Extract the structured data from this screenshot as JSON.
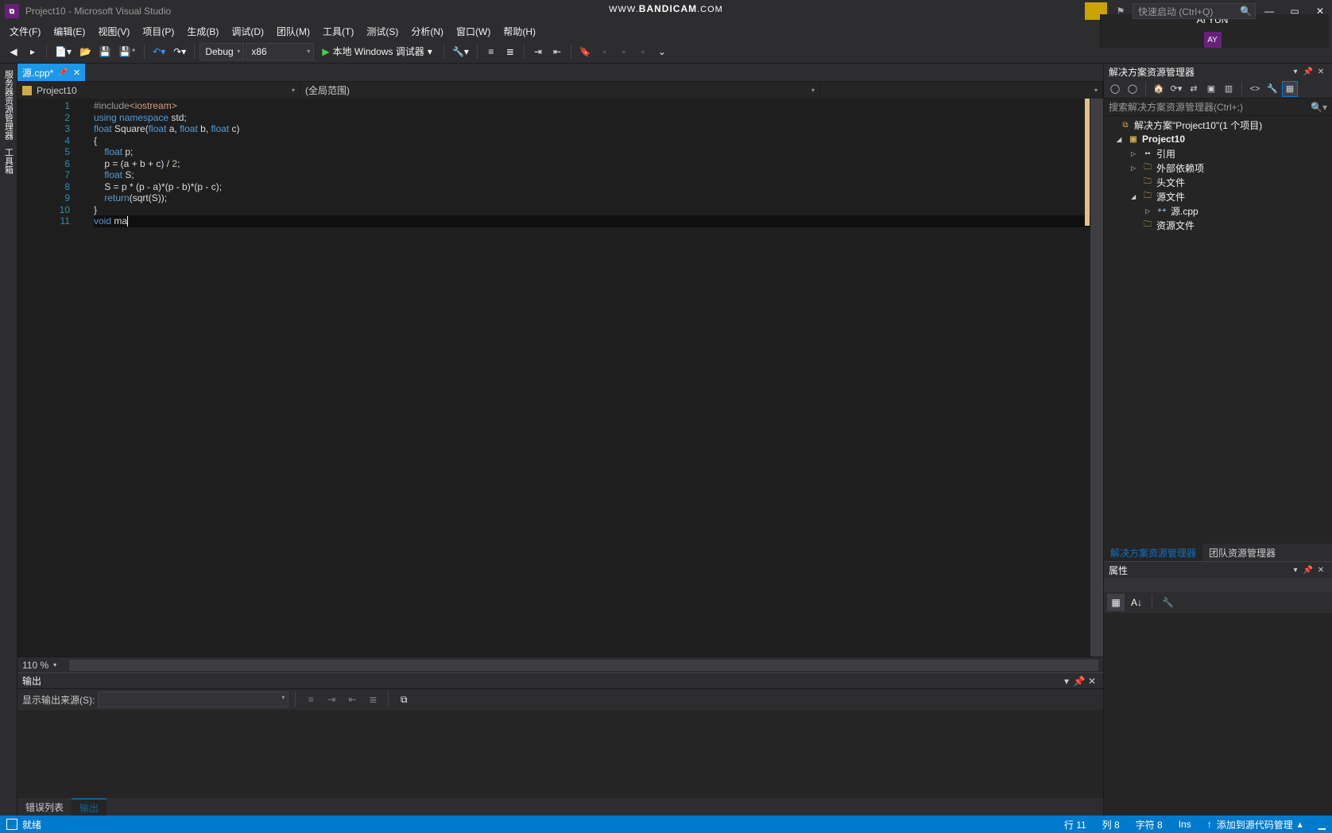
{
  "title": "Project10 - Microsoft Visual Studio",
  "watermark_prefix": "WWW.",
  "watermark_main": "BANDICAM",
  "watermark_suffix": ".COM",
  "quicklaunch_placeholder": "快速启动 (Ctrl+Q)",
  "menu": [
    "文件(F)",
    "编辑(E)",
    "视图(V)",
    "项目(P)",
    "生成(B)",
    "调试(D)",
    "团队(M)",
    "工具(T)",
    "测试(S)",
    "分析(N)",
    "窗口(W)",
    "帮助(H)"
  ],
  "user_label": "AI YUN",
  "user_initials": "AY",
  "toolbar": {
    "config": "Debug",
    "platform": "x86",
    "run": "本地 Windows 调试器"
  },
  "rails": [
    "服务器资源管理器",
    "工具箱"
  ],
  "tab_name": "源.cpp*",
  "nav": {
    "project": "Project10",
    "scope": "(全局范围)"
  },
  "code": {
    "lines": [
      {
        "n": 1,
        "html": "<span class='inc'>#include</span><span class='incpath'>&lt;iostream&gt;</span>"
      },
      {
        "n": 2,
        "html": "<span class='kw'>using</span> <span class='kw'>namespace</span> std;"
      },
      {
        "n": 3,
        "html": "<span class='type'>float</span> Square(<span class='type'>float</span> a, <span class='type'>float</span> b, <span class='type'>float</span> c)"
      },
      {
        "n": 4,
        "html": "{"
      },
      {
        "n": 5,
        "html": "    <span class='type'>float</span> p;"
      },
      {
        "n": 6,
        "html": "    p = (a + b + c) / <span class='num'>2</span>;"
      },
      {
        "n": 7,
        "html": "    <span class='type'>float</span> S;"
      },
      {
        "n": 8,
        "html": "    S = p * (p - a)*(p - b)*(p - c);"
      },
      {
        "n": 9,
        "html": "    <span class='kw'>return</span>(sqrt(S));"
      },
      {
        "n": 10,
        "html": "}"
      },
      {
        "n": 11,
        "html": "<span class='type'>void</span> ma<span class='caret'></span>",
        "cur": true
      }
    ]
  },
  "zoom": "110 %",
  "output": {
    "title": "输出",
    "source_label": "显示输出来源(S):"
  },
  "out_tabs": [
    "错误列表",
    "输出"
  ],
  "out_tabs_active": 1,
  "solution": {
    "panel": "解决方案资源管理器",
    "search_placeholder": "搜索解决方案资源管理器(Ctrl+;)",
    "root": "解决方案\"Project10\"(1 个项目)",
    "project": "Project10",
    "nodes": {
      "refs": "引用",
      "ext": "外部依赖项",
      "headers": "头文件",
      "sources": "源文件",
      "srcfile": "源.cpp",
      "res": "资源文件"
    },
    "bottabs": [
      "解决方案资源管理器",
      "团队资源管理器"
    ]
  },
  "props_title": "属性",
  "status": {
    "ready": "就绪",
    "line": "行 11",
    "col": "列 8",
    "char": "字符 8",
    "ins": "Ins",
    "scm": "添加到源代码管理"
  }
}
